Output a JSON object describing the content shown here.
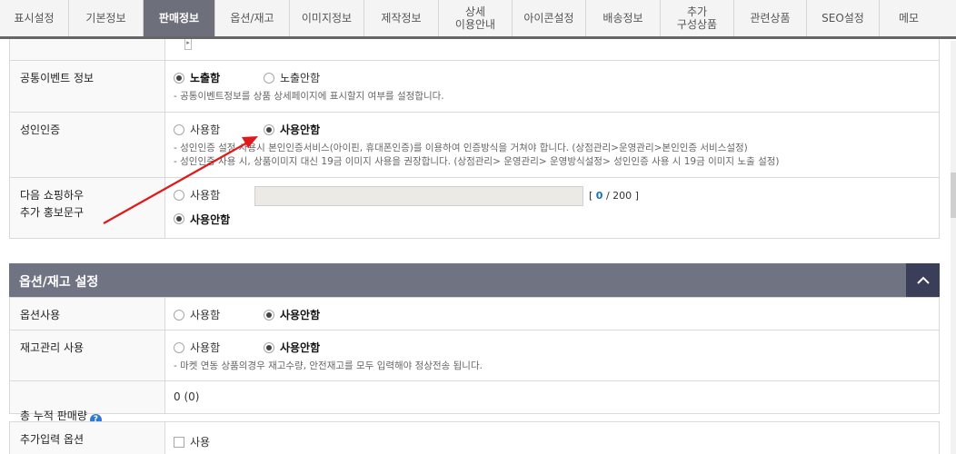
{
  "tabs": [
    {
      "label": "표시설정",
      "active": false
    },
    {
      "label": "기본정보",
      "active": false
    },
    {
      "label": "판매정보",
      "active": true
    },
    {
      "label": "옵션/재고",
      "active": false
    },
    {
      "label": "이미지정보",
      "active": false
    },
    {
      "label": "제작정보",
      "active": false
    },
    {
      "label": "상세\n이용안내",
      "active": false
    },
    {
      "label": "아이콘설정",
      "active": false
    },
    {
      "label": "배송정보",
      "active": false
    },
    {
      "label": "추가\n구성상품",
      "active": false
    },
    {
      "label": "관련상품",
      "active": false
    },
    {
      "label": "SEO설정",
      "active": false
    },
    {
      "label": "메모",
      "active": false
    }
  ],
  "sales": {
    "event": {
      "label": "공통이벤트 정보",
      "opt_on": "노출함",
      "opt_off": "노출안함",
      "selected": "on",
      "desc": "- 공통이벤트정보를 상품 상세페이지에 표시할지 여부를 설정합니다."
    },
    "adult": {
      "label": "성인인증",
      "opt_on": "사용함",
      "opt_off": "사용안함",
      "selected": "off",
      "desc1": "- 성인인증 설정 사용시 본인인증서비스(아이핀, 휴대폰인증)를 이용하여 인증방식을 거쳐야 합니다. (상점관리>운영관리>본인인증 서비스설정)",
      "desc2": "- 성인인증 사용 시, 상품이미지 대신 19금 이미지 사용을 권장합니다. (상점관리> 운영관리> 운영방식설정> 성인인증 사용 시 19금 이미지 노출 설정)"
    },
    "promo": {
      "label": "다음 쇼핑하우\n추가 홍보문구",
      "opt_on": "사용함",
      "opt_off": "사용안함",
      "selected": "off",
      "counter_open": "[",
      "counter_current": "0",
      "counter_sep": "/ 200 ]"
    }
  },
  "option_section": {
    "title": "옵션/재고 설정",
    "option_use": {
      "label": "옵션사용",
      "opt_on": "사용함",
      "opt_off": "사용안함",
      "selected": "off"
    },
    "stock": {
      "label": "재고관리 사용",
      "opt_on": "사용함",
      "opt_off": "사용안함",
      "selected": "off",
      "desc": "- 마켓 연동 상품의경우 재고수량, 안전재고를 모두 입력해야 정상전송 됩니다."
    },
    "total_sales": {
      "label": "총 누적 판매량",
      "help": "?",
      "value": "0 (0)"
    }
  },
  "extra": {
    "label": "추가입력 옵션",
    "checkbox_label": "사용"
  },
  "colors": {
    "active_tab": "#6d6f7a",
    "section_header": "#707382",
    "toggle": "#3b3e58",
    "arrow": "#e01a1a",
    "help": "#2f7ad0"
  }
}
